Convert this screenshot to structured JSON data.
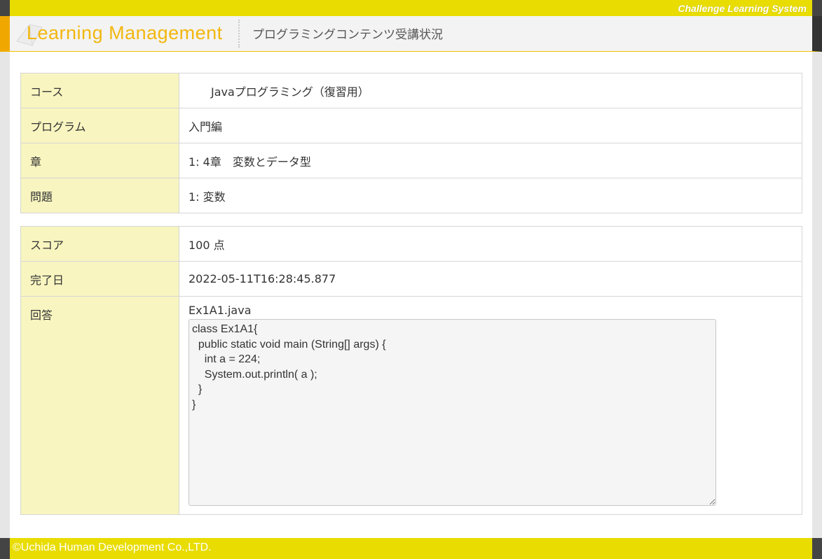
{
  "brand": "Challenge Learning System",
  "header": {
    "logo": "Learning Management",
    "page_title": "プログラミングコンテンツ受講状況"
  },
  "course_info": {
    "course_label": "コース",
    "course_value": "　　Javaプログラミング（復習用）",
    "program_label": "プログラム",
    "program_value": "入門編",
    "chapter_label": "章",
    "chapter_value": "1: 4章　変数とデータ型",
    "problem_label": "問題",
    "problem_value": "1: 変数"
  },
  "result": {
    "score_label": "スコア",
    "score_value": "100 点",
    "completed_label": "完了日",
    "completed_value": "2022-05-11T16:28:45.877",
    "answer_label": "回答",
    "filename": "Ex1A1.java",
    "code": "class Ex1A1{\n  public static void main (String[] args) {\n    int a = 224;\n    System.out.println( a );\n  }\n}"
  },
  "footer": {
    "copyright": "©Uchida Human Development Co.,LTD."
  },
  "colors": {
    "accent_yellow": "#e8dc00",
    "logo_orange": "#f2b70f",
    "label_bg": "#f8f5c0"
  }
}
